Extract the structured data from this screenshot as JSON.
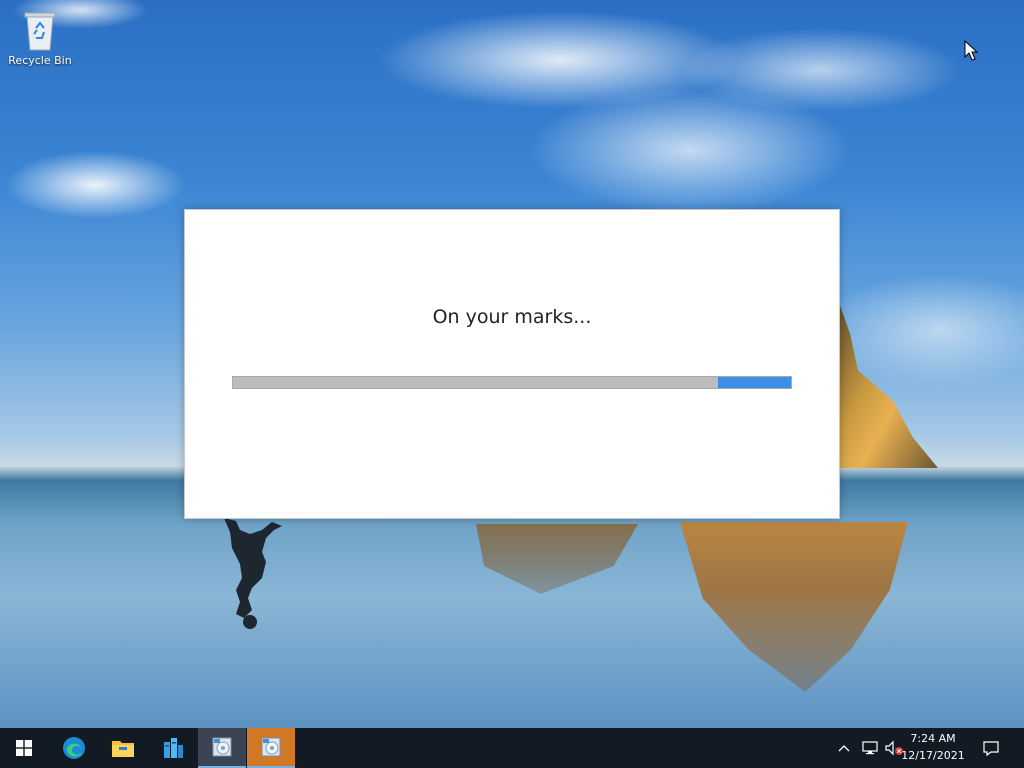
{
  "desktop": {
    "icons": [
      {
        "label": "Recycle Bin",
        "icon": "recycle-bin-icon"
      }
    ]
  },
  "dialog": {
    "message": "On your marks...",
    "progress": {
      "type": "indeterminate",
      "indicator_start_fraction": 0.87,
      "indicator_width_fraction": 0.13
    }
  },
  "taskbar": {
    "start_icon": "windows-logo-icon",
    "pinned": [
      {
        "name": "edge",
        "icon": "edge-icon"
      },
      {
        "name": "file-explorer",
        "icon": "folder-icon"
      },
      {
        "name": "server-manager",
        "icon": "server-manager-icon"
      },
      {
        "name": "installer-app",
        "icon": "installer-icon"
      },
      {
        "name": "installer-app-active",
        "icon": "installer-icon"
      }
    ],
    "tray": {
      "time": "7:24 AM",
      "date": "12/17/2021",
      "icons": [
        "chevron-up-icon",
        "network-icon",
        "volume-muted-icon",
        "notifications-icon"
      ]
    }
  },
  "colors": {
    "accent": "#3c8ee8",
    "taskbar": "#121a24",
    "active_app": "#d27724"
  }
}
